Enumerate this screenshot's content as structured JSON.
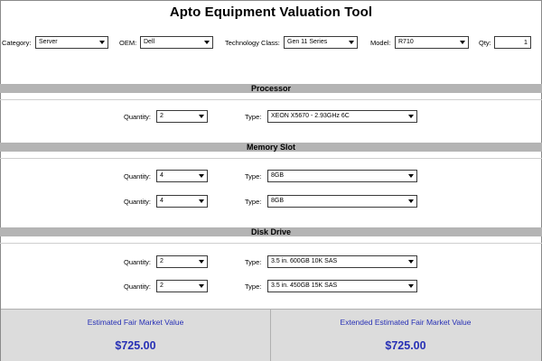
{
  "title": "Apto Equipment Valuation Tool",
  "filters": {
    "category_label": "Category:",
    "category_value": "Server",
    "oem_label": "OEM:",
    "oem_value": "Dell",
    "tech_class_label": "Technology Class:",
    "tech_class_value": "Gen 11 Series",
    "model_label": "Model:",
    "model_value": "R710",
    "qty_label": "Qty:",
    "qty_value": "1"
  },
  "processor": {
    "title": "Processor",
    "rows": [
      {
        "qty_label": "Quantity:",
        "qty": "2",
        "type_label": "Type:",
        "type": "XEON X5670 - 2.93GHz 6C"
      }
    ]
  },
  "memory": {
    "title": "Memory Slot",
    "rows": [
      {
        "qty_label": "Quantity:",
        "qty": "4",
        "type_label": "Type:",
        "type": "8GB"
      },
      {
        "qty_label": "Quantity:",
        "qty": "4",
        "type_label": "Type:",
        "type": "8GB"
      }
    ]
  },
  "disk": {
    "title": "Disk Drive",
    "rows": [
      {
        "qty_label": "Quantity:",
        "qty": "2",
        "type_label": "Type:",
        "type": "3.5 in. 600GB 10K SAS"
      },
      {
        "qty_label": "Quantity:",
        "qty": "2",
        "type_label": "Type:",
        "type": "3.5 in. 450GB 15K SAS"
      }
    ]
  },
  "summary": {
    "fmv_label": "Estimated Fair Market Value",
    "fmv_value": "$725.00",
    "ext_fmv_label": "Extended Estimated Fair Market Value",
    "ext_fmv_value": "$725.00"
  },
  "colors": {
    "accent_text": "#2730b5",
    "section_bar": "#b4b4b4",
    "footer_bg": "#dcdcdc"
  }
}
